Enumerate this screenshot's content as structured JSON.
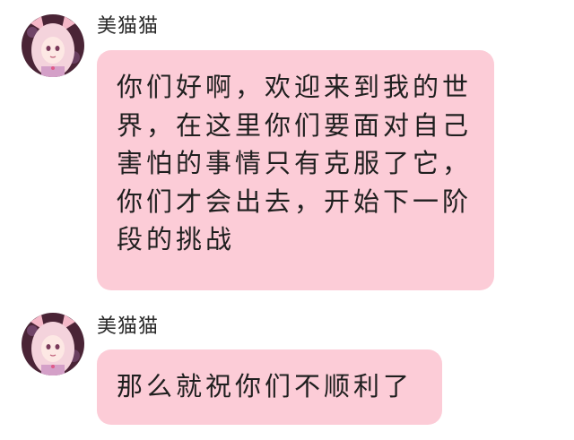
{
  "messages": [
    {
      "sender": "美猫猫",
      "text": "你们好啊，欢迎来到我的世界，在这里你们要面对自己害怕的事情只有克服了它，你们才会出去，开始下一阶段的挑战"
    },
    {
      "sender": "美猫猫",
      "text": "那么就祝你们不顺利了"
    }
  ],
  "colors": {
    "bubble": "#fcccd7",
    "text": "#1f1f1f",
    "avatar_hair": "#f4d3dc",
    "avatar_bg": "#4a2436"
  },
  "icons": [
    "avatar-anime-girl-cat-ears"
  ]
}
